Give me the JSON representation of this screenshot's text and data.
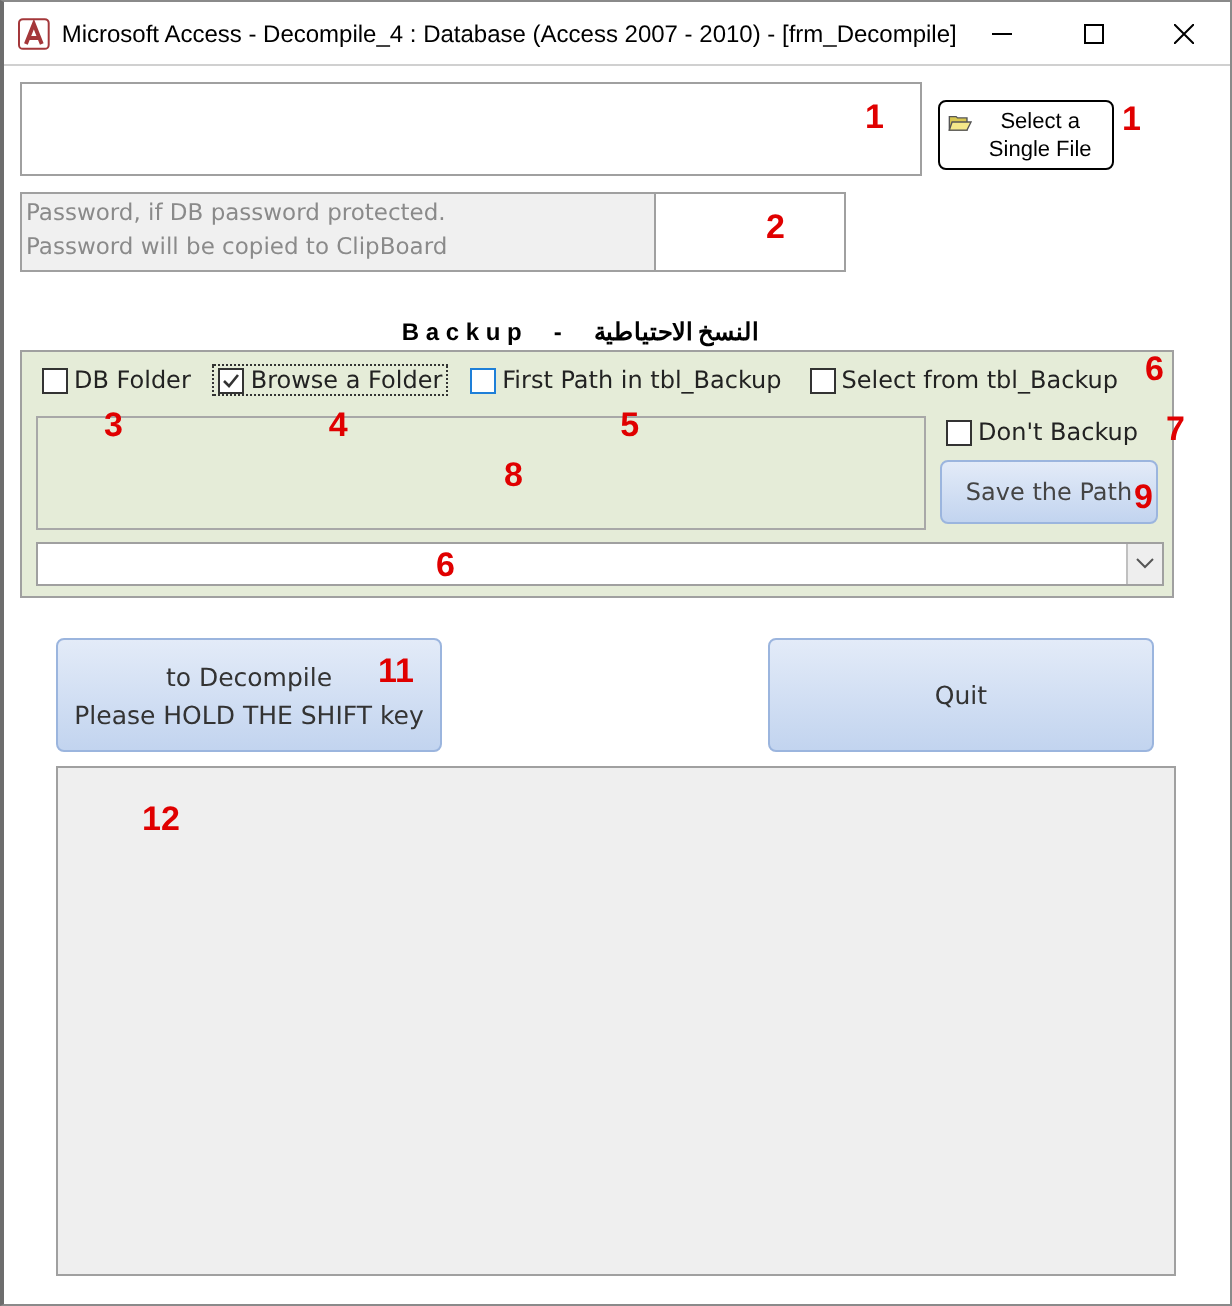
{
  "window": {
    "title": "Microsoft Access - Decompile_4 : Database (Access 2007 - 2010) - [frm_Decompile]"
  },
  "file_field": {
    "marker": "1"
  },
  "select_file_button": {
    "label": "Select a Single File",
    "marker": "1"
  },
  "password": {
    "placeholder": "Password, if DB password protected.\nPassword will be copied to ClipBoard",
    "marker": "2"
  },
  "backup": {
    "title_latin": "B a c k u p",
    "separator": "-",
    "title_arabic": "النسخ الاحتياطية",
    "options": [
      {
        "label": "DB Folder",
        "checked": false,
        "focused": false,
        "hovered": false,
        "marker": "3"
      },
      {
        "label": "Browse a Folder",
        "checked": true,
        "focused": true,
        "hovered": false,
        "marker": "4"
      },
      {
        "label": "First Path in tbl_Backup",
        "checked": false,
        "focused": false,
        "hovered": true,
        "marker": "5"
      },
      {
        "label": "Select from tbl_Backup",
        "checked": false,
        "focused": false,
        "hovered": false,
        "marker": "6"
      }
    ],
    "path_box": {
      "marker": "8"
    },
    "dont_backup": {
      "label": "Don't Backup",
      "checked": false,
      "marker": "7"
    },
    "save_button": {
      "label": "Save the Path",
      "marker": "9"
    },
    "combo": {
      "marker": "6"
    }
  },
  "decompile_button": {
    "label": "to Decompile\nPlease HOLD THE SHIFT key",
    "marker": "11"
  },
  "quit_button": {
    "label": "Quit"
  },
  "log_box": {
    "marker": "12"
  }
}
